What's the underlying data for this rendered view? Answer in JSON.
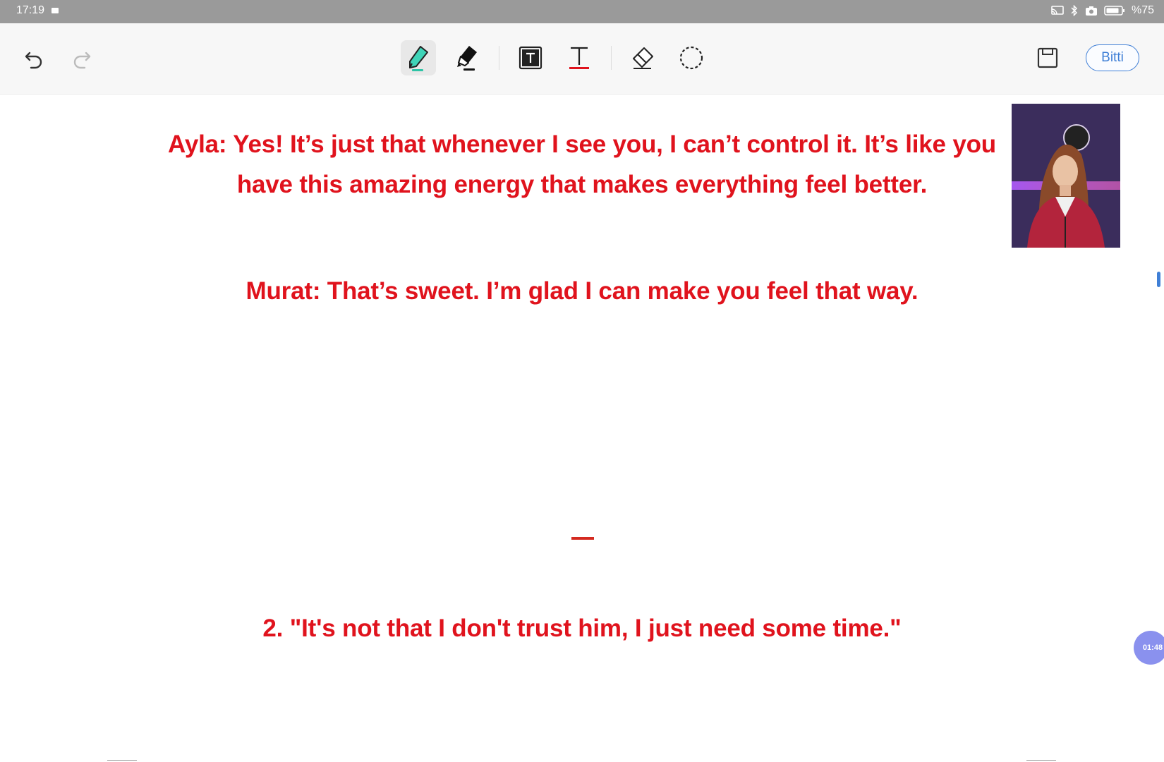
{
  "status_bar": {
    "time": "17:19",
    "battery_text": "%75",
    "icons": [
      "screen-cast-icon",
      "bluetooth-icon",
      "camera-icon",
      "battery-icon"
    ]
  },
  "toolbar": {
    "tools": [
      "undo-icon",
      "redo-icon",
      "pen-icon",
      "marker-icon",
      "textbox-icon",
      "text-cursor-icon",
      "eraser-icon",
      "lasso-icon",
      "save-icon"
    ],
    "pen_color": "#2ec4a6",
    "done_label": "Bitti",
    "accent": "#3f7fd6"
  },
  "canvas": {
    "ayla_line": "Ayla: Yes! It’s just that whenever I see you, I can’t control it. It’s like you have this amazing energy that makes everything feel better.",
    "murat_line": "Murat: That’s sweet. I’m glad I can make you feel that way.",
    "numbered_line": "2. \"It's not that I don't trust him, I just need some time.\"",
    "text_color": "#e0131d"
  },
  "overlay": {
    "timer": "01:48"
  }
}
